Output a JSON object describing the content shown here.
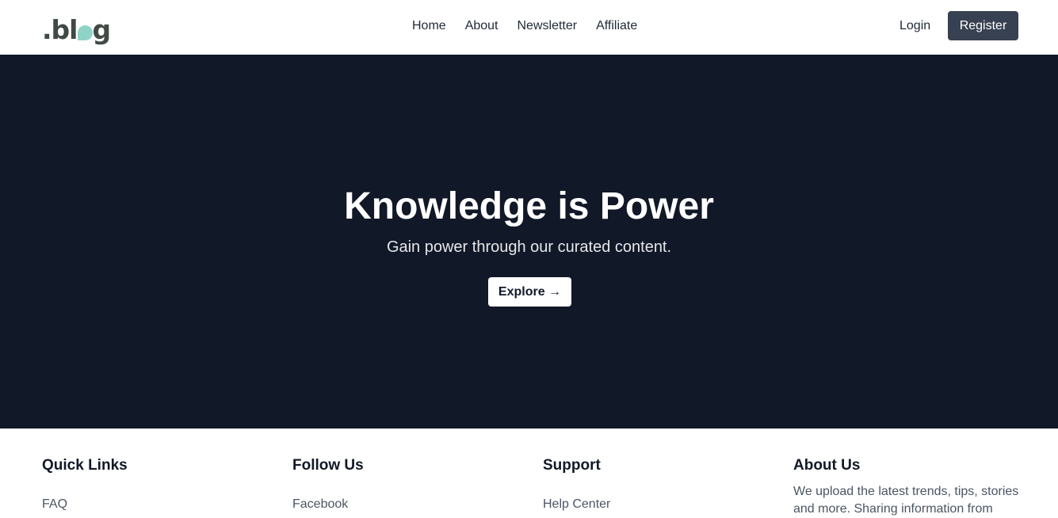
{
  "brand": {
    "logo_text_start": ".bl",
    "logo_text_end": "g"
  },
  "nav": {
    "items": [
      "Home",
      "About",
      "Newsletter",
      "Affiliate"
    ]
  },
  "auth": {
    "login_label": "Login",
    "register_label": "Register"
  },
  "hero": {
    "title": "Knowledge is Power",
    "subtitle": "Gain power through our curated content.",
    "cta_label": "Explore →"
  },
  "footer": {
    "quick_links": {
      "title": "Quick Links",
      "first_link": "FAQ"
    },
    "follow_us": {
      "title": "Follow Us",
      "first_link": "Facebook"
    },
    "support": {
      "title": "Support",
      "first_link": "Help Center"
    },
    "about_us": {
      "title": "About Us",
      "text": "We upload the latest trends, tips, stories and more. Sharing information from"
    }
  },
  "colors": {
    "hero_bg": "#111827",
    "register_bg": "#374151",
    "logo_bubble": "#8fd3c6",
    "logo_text": "#3f4a44"
  },
  "icons": {
    "logo_bubble": "speech-bubble-icon"
  }
}
